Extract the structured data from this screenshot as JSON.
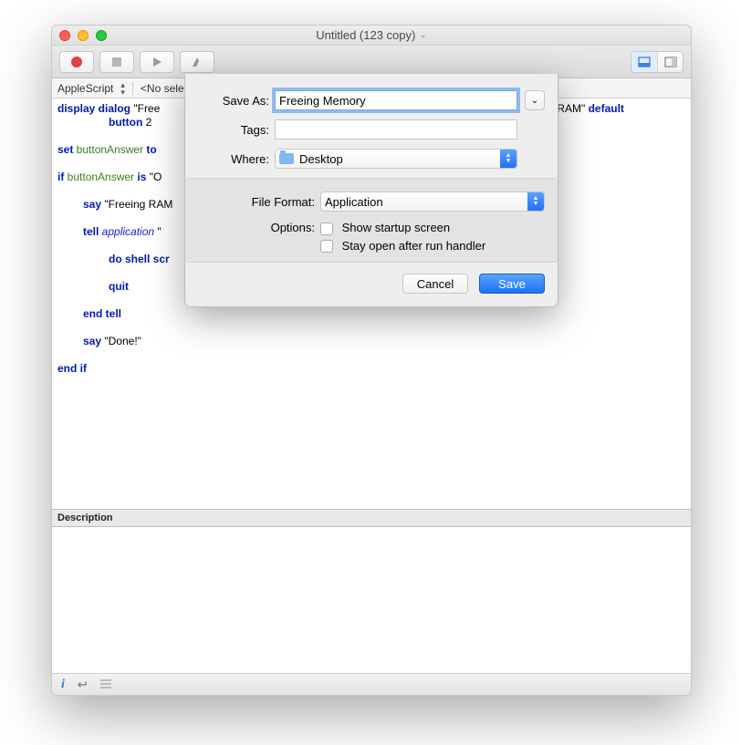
{
  "window": {
    "title": "Untitled (123 copy)"
  },
  "subbar": {
    "lang": "AppleScript",
    "nosel": "<No sele"
  },
  "code": {
    "l1a": "display dialog",
    "l1b": " \"Free",
    "l1c": "g RAM\" ",
    "l1d": "default",
    "l2a": "button",
    "l2b": " 2",
    "l3a": "set",
    "l3b": " buttonAnswer",
    "l3c": " to ",
    "l4a": "if",
    "l4b": " buttonAnswer",
    "l4c": " is",
    "l4d": " \"O",
    "l5a": "say",
    "l5b": " \"Freeing RAM",
    "l6a": "tell",
    "l6b": " application",
    "l6c": " \"",
    "l7a": "do shell scr",
    "l8a": "quit",
    "l9a": "end tell",
    "l10a": "say",
    "l10b": " \"Done!\"",
    "l11a": "end if"
  },
  "description": {
    "label": "Description"
  },
  "sheet": {
    "saveAsLabel": "Save As:",
    "saveAsValue": "Freeing Memory",
    "tagsLabel": "Tags:",
    "whereLabel": "Where:",
    "whereValue": "Desktop",
    "fileFormatLabel": "File Format:",
    "fileFormatValue": "Application",
    "optionsLabel": "Options:",
    "opt1": "Show startup screen",
    "opt2": "Stay open after run handler",
    "cancel": "Cancel",
    "save": "Save"
  }
}
